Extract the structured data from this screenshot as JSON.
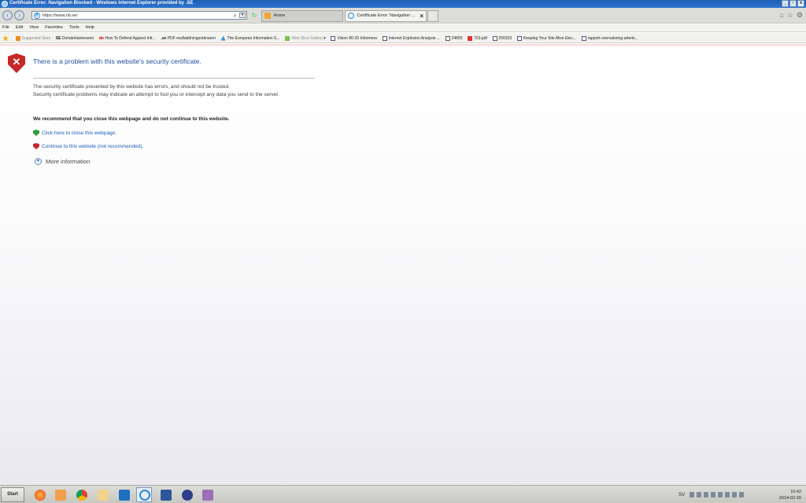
{
  "window": {
    "title": "Certificate Error: Navigation Blocked - Windows Internet Explorer provided by .SE",
    "buttons": {
      "minimize": "_",
      "maximize": "▫",
      "close": "x"
    }
  },
  "address_bar": {
    "url": "https://www.nb.se/"
  },
  "tabs": [
    {
      "label": "Home"
    },
    {
      "label": "Certificate Error: Navigation ...",
      "close": "×"
    }
  ],
  "menu": [
    "File",
    "Edit",
    "View",
    "Favorites",
    "Tools",
    "Help"
  ],
  "favorites": [
    {
      "label": "Suggested Sites"
    },
    {
      "label": "Domänhanteraren",
      "icon_text": "SE"
    },
    {
      "label": "How To Defend Against Infr...",
      "icon_text": "dn"
    },
    {
      "label": "PDF-nedladdningsräknaren",
      "icon_text": ".se"
    },
    {
      "label": "The European Information S..."
    },
    {
      "label": "Web Slice Gallery"
    },
    {
      "label": "Vision 80-20 Informera"
    },
    {
      "label": "Internet Explosion Analysis ..."
    },
    {
      "label": "24855"
    },
    {
      "label": "763.pdf"
    },
    {
      "label": "200323"
    },
    {
      "label": "Keeping Your Site Alive  Elec..."
    },
    {
      "label": "rapport-overvakning-arbets..."
    }
  ],
  "error_page": {
    "title": "There is a problem with this website's security certificate.",
    "line1": "The security certificate presented by this website has errors, and should not be trusted.",
    "line2": "Security certificate problems may indicate an attempt to fool you or intercept any data you send to the server.",
    "recommendation": "We recommend that you close this webpage and do not continue to this website.",
    "close_link": "Click here to close this webpage.",
    "continue_link": "Continue to this website (not recommended).",
    "more_info": "More information"
  },
  "taskbar": {
    "start": "Start",
    "language": "SV",
    "time": "10:42",
    "date": "2014-02-20"
  }
}
